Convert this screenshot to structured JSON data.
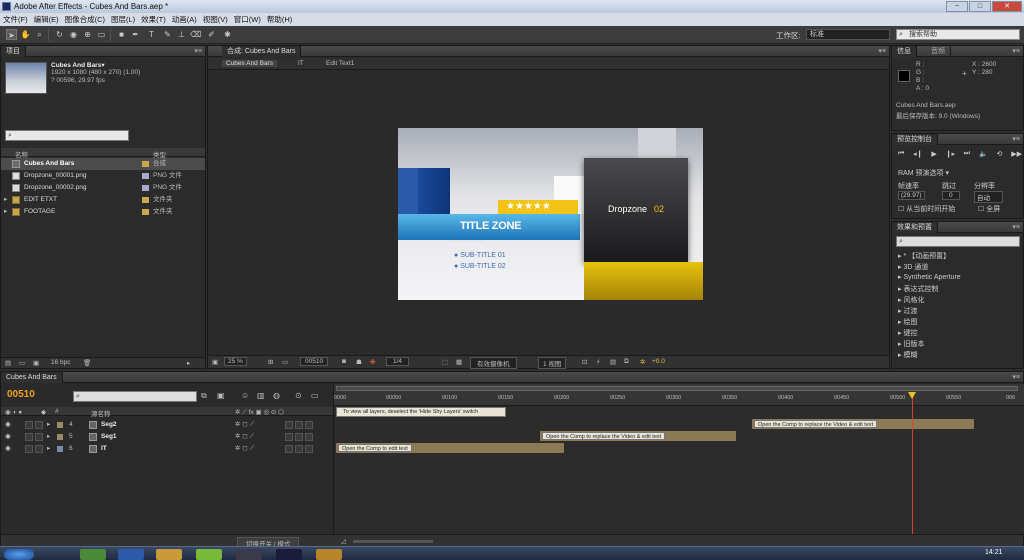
{
  "window": {
    "title": "Adobe After Effects - Cubes And Bars.aep *",
    "btn_min": "−",
    "btn_max": "□",
    "btn_close": "✕"
  },
  "menu": [
    "文件(F)",
    "编辑(E)",
    "图像合成(C)",
    "图层(L)",
    "效果(T)",
    "动画(A)",
    "视图(V)",
    "窗口(W)",
    "帮助(H)"
  ],
  "toolbar": {
    "workspace_label": "工作区:",
    "workspace_value": "标准",
    "search_placeholder": "搜索帮助"
  },
  "project": {
    "tab": "项目",
    "comp_name": "Cubes And Bars▾",
    "comp_info1": "1920 x 1080 (480 x 270) (1.00)",
    "comp_info2": "? 00596, 29.97 fps",
    "col_name": "名称",
    "col_type": "类型",
    "items": [
      {
        "name": "Cubes And Bars",
        "type": "合成",
        "label": "#c8a84a",
        "kind": "comp"
      },
      {
        "name": "Dropzone_00001.png",
        "type": "PNG 文件",
        "label": "#a8a8c8",
        "kind": "file"
      },
      {
        "name": "Dropzone_00002.png",
        "type": "PNG 文件",
        "label": "#a8a8c8",
        "kind": "file"
      },
      {
        "name": "EDIT ETXT",
        "type": "文件夹",
        "label": "#c8a84a",
        "kind": "folder"
      },
      {
        "name": "FOOTAGE",
        "type": "文件夹",
        "label": "#c8a84a",
        "kind": "folder"
      }
    ],
    "bpc": "16 bpc"
  },
  "composition": {
    "tab": "合成: Cubes And Bars",
    "crumbs": [
      "Cubes And Bars",
      "IT",
      "Edit Text1"
    ],
    "scene": {
      "title_zone": "TITLE ZONE",
      "sub1": "SUB-TITLE 01",
      "sub2": "SUB-TITLE 02",
      "drop_a": "Dropzone",
      "drop_b": "02",
      "stars": "★★★★★"
    },
    "footer": {
      "zoom": "25 %",
      "timecode": "00510",
      "resolution": "1/4",
      "camera": "有效摄像机",
      "views": "1 视图",
      "exposure": "+0.0"
    }
  },
  "info": {
    "tab_info": "信息",
    "tab_audio": "音频",
    "r": "R :",
    "g": "G :",
    "b": "B :",
    "a": "A : 0",
    "x": "X : 2600",
    "y": "Y : 280",
    "file": "Cubes And Bars.aep",
    "saved": "最后保存版本: 9.0 (Windows)"
  },
  "preview": {
    "tab": "预览控制台",
    "ram": "RAM 预演选项",
    "lbl_rate": "帧速率",
    "lbl_skip": "跳过",
    "lbl_res": "分辨率",
    "val_rate": "(29.97)",
    "val_skip": "0",
    "val_res": "自动",
    "from_current": "从当前时间开始",
    "fullscreen": "全屏"
  },
  "effects": {
    "tab": "效果和预置",
    "items": [
      "* 【动画预置】",
      "3D 通道",
      "Synthetic Aperture",
      "表达式控制",
      "风格化",
      "过渡",
      "绘图",
      "键控",
      "旧版本",
      "模糊"
    ]
  },
  "timeline": {
    "tab": "Cubes And Bars",
    "timecode": "00510",
    "col_source": "源名称",
    "hint": "To view all layers, deselect the 'Hide Shy Layers' switch",
    "ticks": [
      "0000",
      "00050",
      "00100",
      "00150",
      "00200",
      "00250",
      "00300",
      "00350",
      "00400",
      "00450",
      "00500",
      "00550",
      "006"
    ],
    "layers": [
      {
        "num": "4",
        "name": "Seg2",
        "color": "#9a8a68"
      },
      {
        "num": "5",
        "name": "Seg1",
        "color": "#9a8a68"
      },
      {
        "num": "6",
        "name": "IT",
        "color": "#7a8aa8"
      }
    ],
    "bars": [
      {
        "label": "Open the Comp to replace the Video & edit text"
      },
      {
        "label": "Open the Comp to replace the Video & edit text"
      },
      {
        "label": "Open the Comp to edit text"
      }
    ],
    "toggle": "切换开关 / 模式"
  },
  "taskbar": {
    "clock": "14:21"
  }
}
